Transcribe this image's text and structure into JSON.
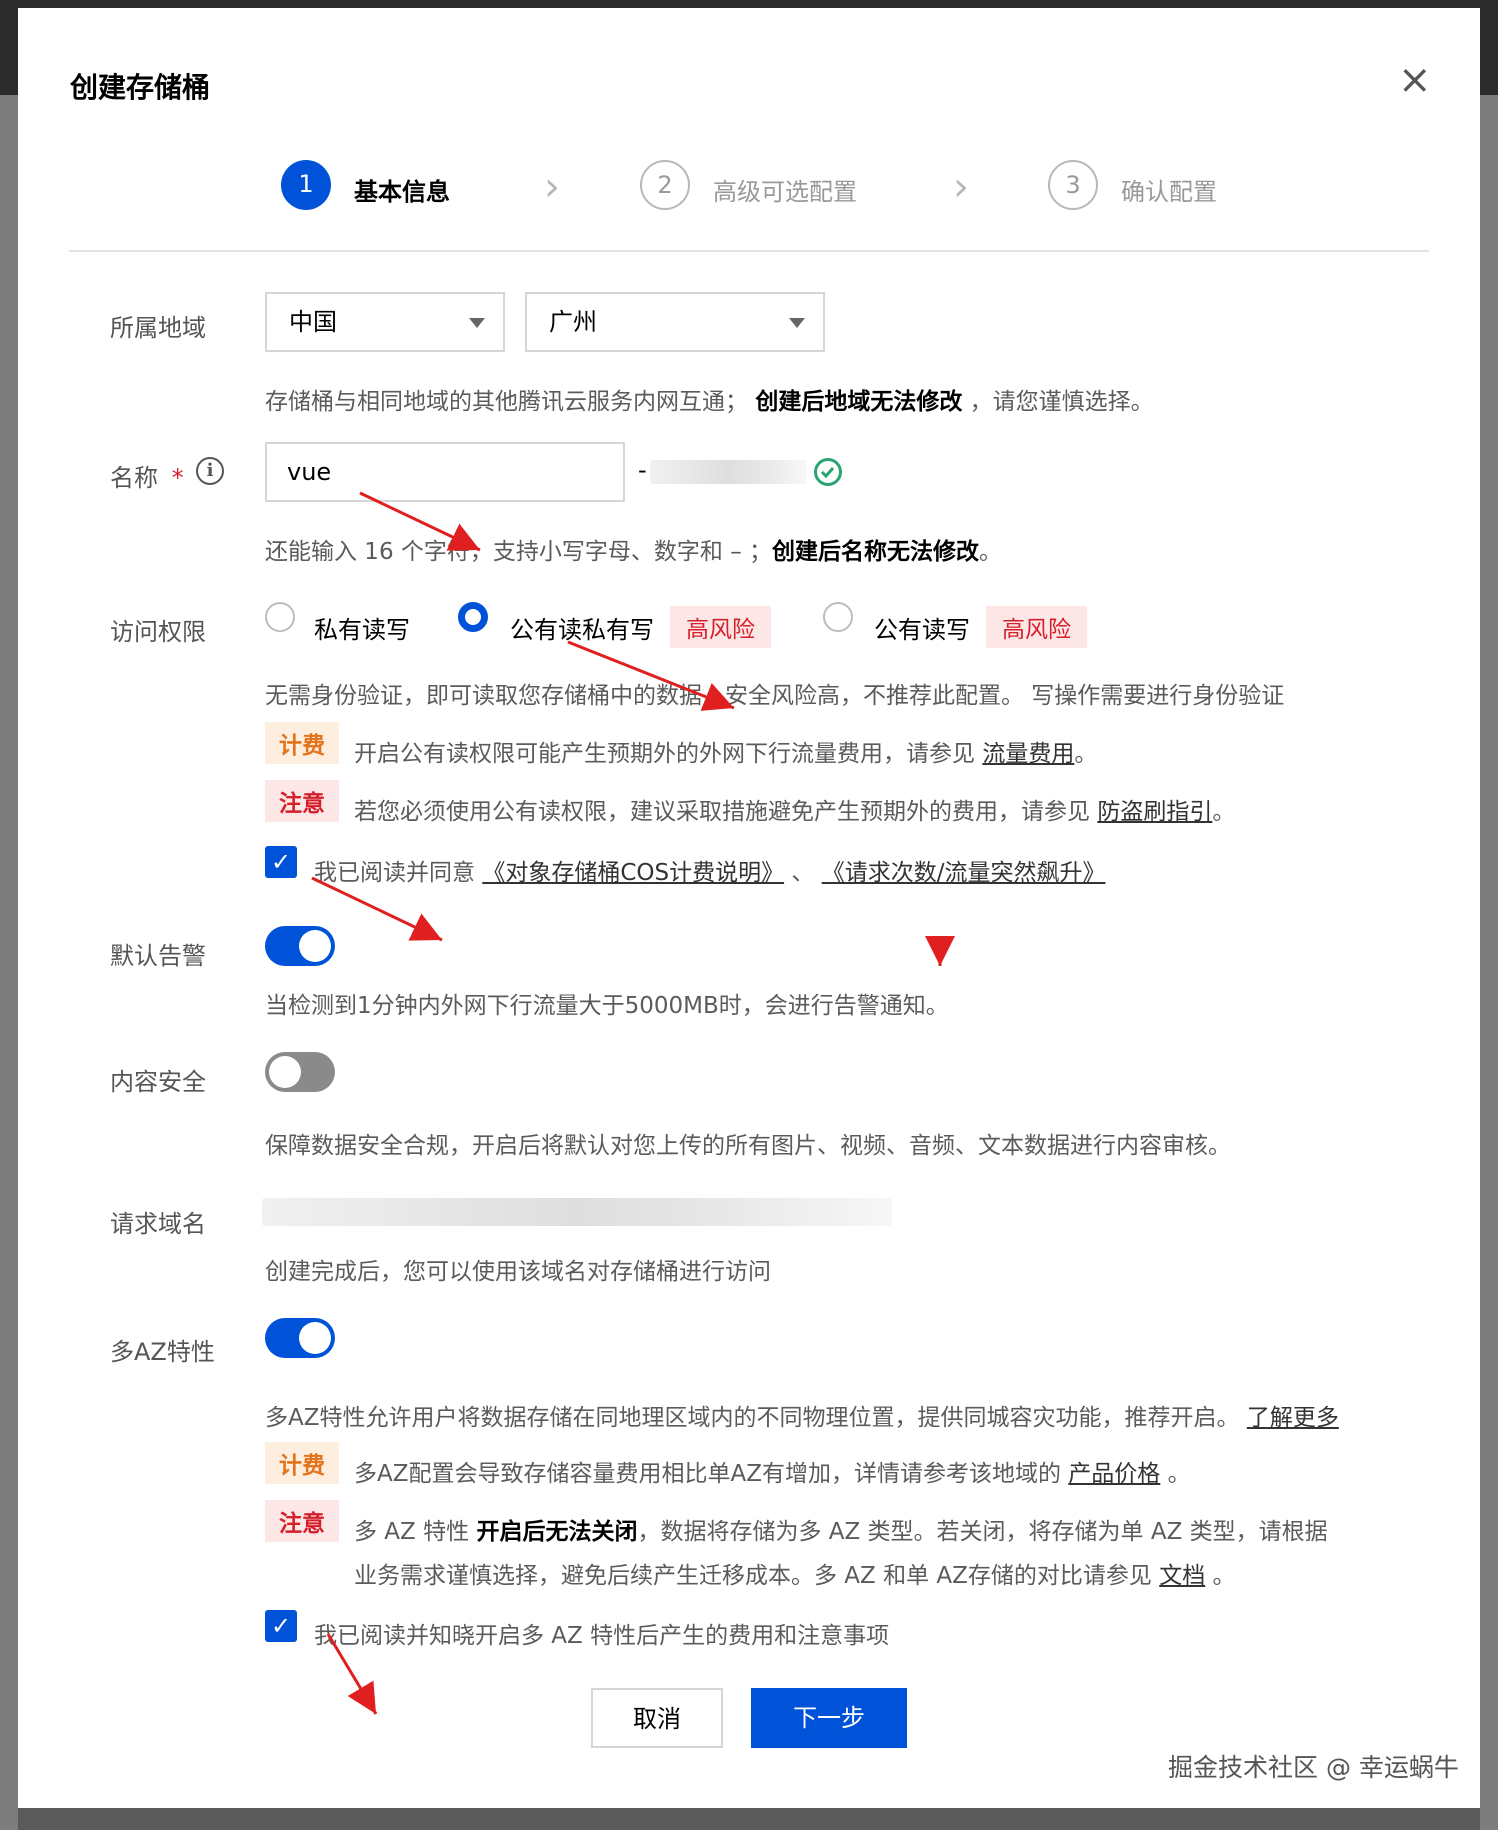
{
  "dialog": {
    "title": "创建存储桶",
    "close_glyph": "×"
  },
  "steps": [
    {
      "num": "1",
      "label": "基本信息",
      "state": "active"
    },
    {
      "num": "2",
      "label": "高级可选配置",
      "state": "inactive"
    },
    {
      "num": "3",
      "label": "确认配置",
      "state": "inactive"
    }
  ],
  "region": {
    "label": "所属地域",
    "country": "中国",
    "city": "广州",
    "desc_pre": "存储桶与相同地域的其他腾讯云服务内网互通；",
    "desc_bold": "创建后地域无法修改",
    "desc_post": "，请您谨慎选择。"
  },
  "name": {
    "label": "名称",
    "required_mark": "*",
    "value": "vue",
    "suffix_dash": "-",
    "desc_pre": "还能输入 16 个字符，支持小写字母、数字和 – ；",
    "desc_bold": "创建后名称无法修改",
    "desc_post": "。"
  },
  "access": {
    "label": "访问权限",
    "options": [
      {
        "label": "私有读写",
        "selected": false
      },
      {
        "label": "公有读私有写",
        "selected": true,
        "risk": "高风险"
      },
      {
        "label": "公有读写",
        "selected": false,
        "risk": "高风险"
      }
    ],
    "desc": "无需身份验证，即可读取您存储桶中的数据，安全风险高，不推荐此配置。 写操作需要进行身份验证",
    "fee_tag": "计费",
    "fee_text": "开启公有读权限可能产生预期外的外网下行流量费用，请参见",
    "fee_link": "流量费用",
    "fee_end": "。",
    "note_tag": "注意",
    "note_text": "若您必须使用公有读权限，建议采取措施避免产生预期外的费用，请参见",
    "note_link": "防盗刷指引",
    "note_end": "。",
    "agree_text": "我已阅读并同意",
    "agree_link1": "《对象存储桶COS计费说明》",
    "agree_sep": "、",
    "agree_link2": "《请求次数/流量突然飙升》"
  },
  "alarm": {
    "label": "默认告警",
    "enabled": true,
    "desc": "当检测到1分钟内外网下行流量大于5000MB时，会进行告警通知。"
  },
  "content_safety": {
    "label": "内容安全",
    "enabled": false,
    "desc": "保障数据安全合规，开启后将默认对您上传的所有图片、视频、音频、文本数据进行内容审核。"
  },
  "domain": {
    "label": "请求域名",
    "desc": "创建完成后，您可以使用该域名对存储桶进行访问"
  },
  "multi_az": {
    "label": "多AZ特性",
    "enabled": true,
    "desc": "多AZ特性允许用户将数据存储在同地理区域内的不同物理位置，提供同城容灾功能，推荐开启。",
    "desc_link": "了解更多",
    "fee_tag": "计费",
    "fee_text": "多AZ配置会导致存储容量费用相比单AZ有增加，详情请参考该地域的",
    "fee_link": "产品价格",
    "fee_end": "。",
    "note_tag": "注意",
    "note_l1_pre": "多 AZ 特性",
    "note_l1_bold": "开启后无法关闭",
    "note_l1_post": "，数据将存储为多 AZ 类型。若关闭，将存储为单 AZ 类型，请根据",
    "note_l2": "业务需求谨慎选择，避免后续产生迁移成本。多 AZ 和单 AZ存储的对比请参见",
    "note_link": "文档",
    "note_end": "。",
    "agree_text": "我已阅读并知晓开启多 AZ 特性后产生的费用和注意事项"
  },
  "footer": {
    "cancel": "取消",
    "next": "下一步"
  },
  "watermark": "掘金技术社区 @ 幸运蜗牛",
  "colors": {
    "primary": "#0052d9",
    "danger": "#d5202c",
    "warning": "#e37318",
    "success": "#2ba471"
  }
}
